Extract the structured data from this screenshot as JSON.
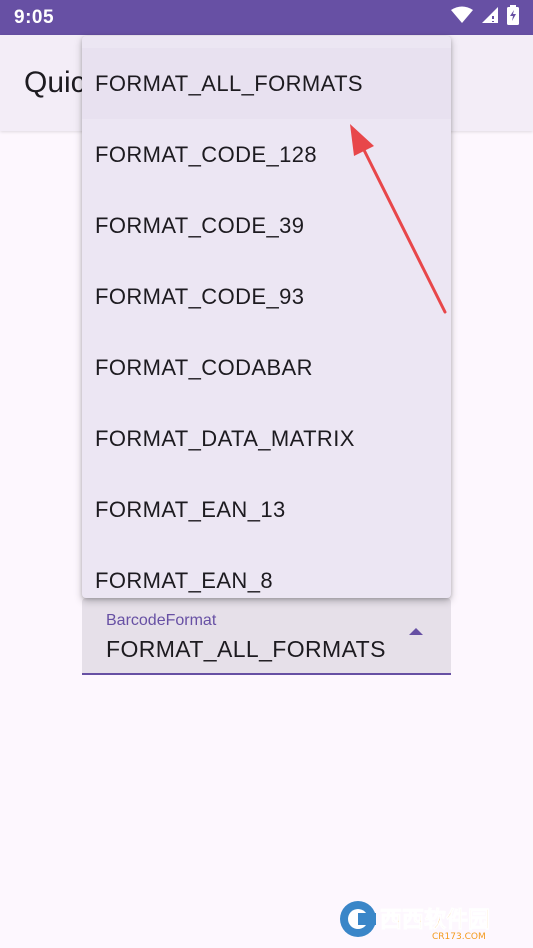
{
  "status_bar": {
    "time": "9:05",
    "icons": [
      "wifi-icon",
      "signal-icon",
      "battery-icon"
    ]
  },
  "app_bar": {
    "title": "Quick"
  },
  "dropdown": {
    "items": [
      {
        "label": "FORMAT_ALL_FORMATS",
        "selected": true
      },
      {
        "label": "FORMAT_CODE_128"
      },
      {
        "label": "FORMAT_CODE_39"
      },
      {
        "label": "FORMAT_CODE_93"
      },
      {
        "label": "FORMAT_CODABAR"
      },
      {
        "label": "FORMAT_DATA_MATRIX"
      },
      {
        "label": "FORMAT_EAN_13"
      },
      {
        "label": "FORMAT_EAN_8"
      }
    ]
  },
  "field": {
    "label": "BarcodeFormat",
    "value": "FORMAT_ALL_FORMATS",
    "icon": "arrow-drop-up-icon"
  },
  "watermark": {
    "text": "西西软件园",
    "subtext": "CR173.COM"
  },
  "colors": {
    "primary": "#6750a4",
    "background": "#fdf7fe",
    "menu_surface": "#ece6f3",
    "field_surface": "#e6e0e9",
    "annotation_arrow": "#e8474a"
  }
}
